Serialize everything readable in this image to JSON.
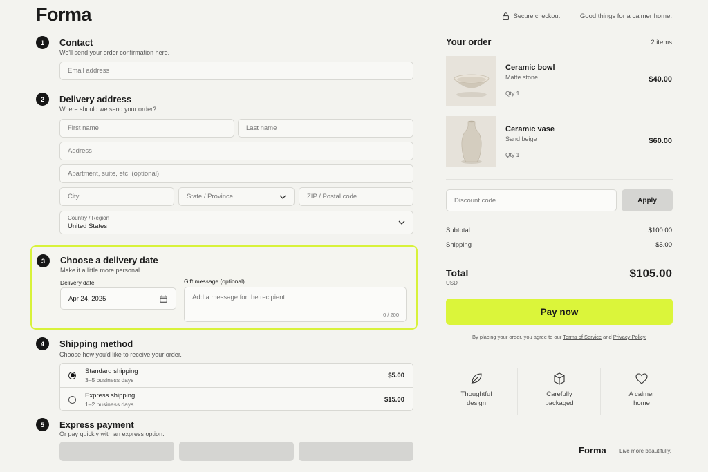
{
  "header": {
    "brand": "Forma",
    "secure_checkout": "Secure checkout",
    "tagline": "Good things for a calmer home."
  },
  "contact": {
    "number": "1",
    "title": "Contact",
    "subtitle": "We'll send your order confirmation here.",
    "email_placeholder": "Email address"
  },
  "delivery_address": {
    "number": "2",
    "title": "Delivery address",
    "subtitle": "Where should we send your order?",
    "first_name_placeholder": "First name",
    "last_name_placeholder": "Last name",
    "address_placeholder": "Address",
    "apartment_placeholder": "Apartment, suite, etc. (optional)",
    "city_placeholder": "City",
    "state_placeholder": "State / Province",
    "zip_placeholder": "ZIP / Postal code",
    "country_label": "Country / Region",
    "country_value": "United States"
  },
  "delivery_date": {
    "number": "3",
    "title": "Choose a delivery date",
    "subtitle": "Make it a little more personal.",
    "date_label": "Delivery date",
    "date_value": "Apr 24, 2025",
    "gift_label": "Gift message (optional)",
    "gift_placeholder": "Add a message for the recipient...",
    "gift_counter": "0 / 200"
  },
  "shipping": {
    "number": "4",
    "title": "Shipping method",
    "subtitle": "Choose how you'd like to receive your order.",
    "options": [
      {
        "name": "Standard shipping",
        "days": "3–5 business days",
        "price": "$5.00",
        "selected": true
      },
      {
        "name": "Express shipping",
        "days": "1–2 business days",
        "price": "$15.00",
        "selected": false
      }
    ]
  },
  "express": {
    "number": "5",
    "title": "Express payment",
    "subtitle": "Or pay quickly with an express option."
  },
  "order": {
    "title": "Your order",
    "count": "2 items",
    "items": [
      {
        "name": "Ceramic bowl",
        "variant": "Matte stone",
        "qty": "Qty 1",
        "price": "$40.00"
      },
      {
        "name": "Ceramic vase",
        "variant": "Sand beige",
        "qty": "Qty 1",
        "price": "$60.00"
      }
    ],
    "discount_placeholder": "Discount code",
    "apply_label": "Apply",
    "subtotal_label": "Subtotal",
    "subtotal_value": "$100.00",
    "shipping_label": "Shipping",
    "shipping_value": "$5.00",
    "total_label": "Total",
    "currency": "USD",
    "total_value": "$105.00",
    "pay_label": "Pay now",
    "terms_prefix": "By placing your order, you agree to our",
    "terms_link": "Terms of Service",
    "terms_and": "and",
    "privacy_link": "Privacy Policy."
  },
  "features": [
    {
      "icon": "leaf-icon",
      "line1": "Thoughtful",
      "line2": "design"
    },
    {
      "icon": "box-icon",
      "line1": "Carefully",
      "line2": "packaged"
    },
    {
      "icon": "heart-icon",
      "line1": "A calmer",
      "line2": "home"
    }
  ],
  "footer": {
    "brand": "Forma",
    "slogan": "Live more beautifully."
  },
  "colors": {
    "accent": "#dbf53a",
    "background": "#f3f3ef",
    "text": "#1b1b1b"
  }
}
